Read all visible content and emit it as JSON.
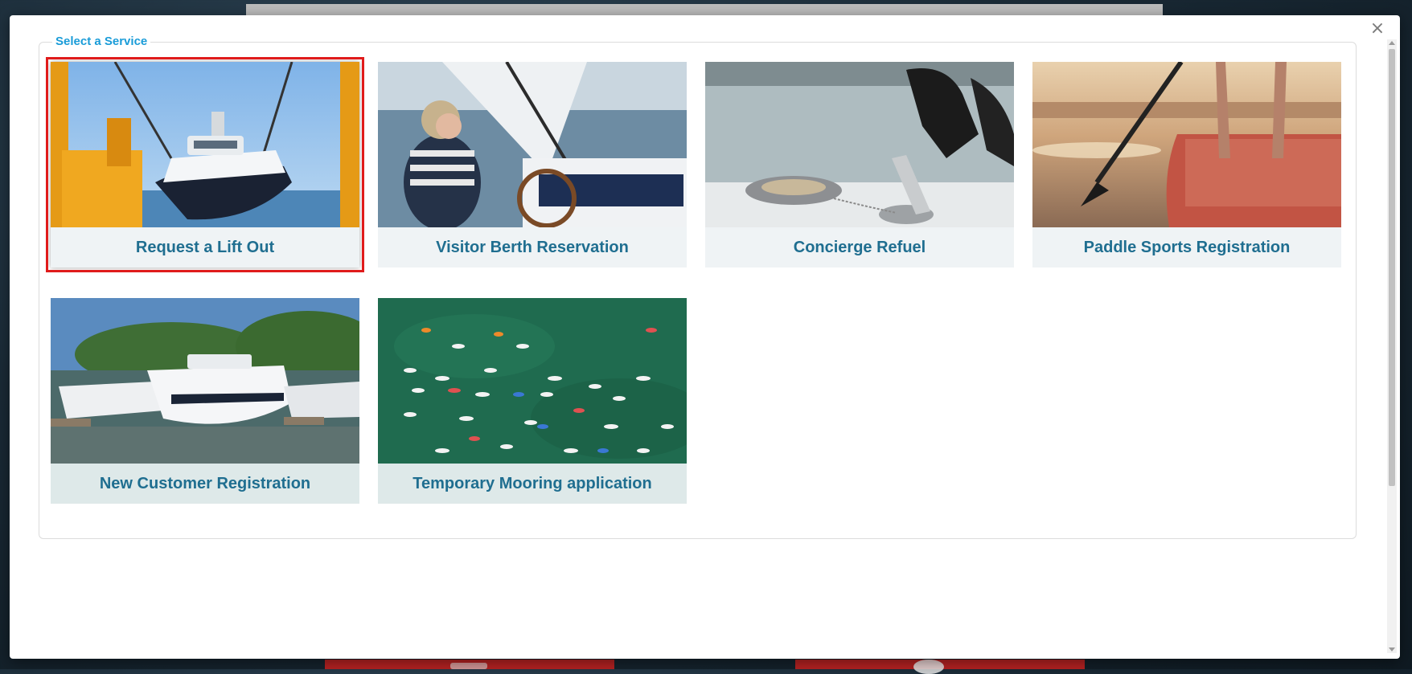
{
  "modal": {
    "close_glyph": "×",
    "section_title": "Select a Service"
  },
  "services": [
    {
      "label": "Request a Lift Out",
      "icon": "boat-lift-photo",
      "selected": true
    },
    {
      "label": "Visitor Berth Reservation",
      "icon": "sailing-helm-photo",
      "selected": false
    },
    {
      "label": "Concierge Refuel",
      "icon": "fuel-nozzle-photo",
      "selected": false
    },
    {
      "label": "Paddle Sports Registration",
      "icon": "paddleboard-photo",
      "selected": false
    },
    {
      "label": "New Customer Registration",
      "icon": "marina-yachts-photo",
      "selected": false
    },
    {
      "label": "Temporary Mooring application",
      "icon": "moored-boats-aerial-photo",
      "selected": false
    }
  ],
  "colors": {
    "accent": "#1a9cd8",
    "tile_label_text": "#1f6e90",
    "selection_outline": "#e01b1b"
  }
}
